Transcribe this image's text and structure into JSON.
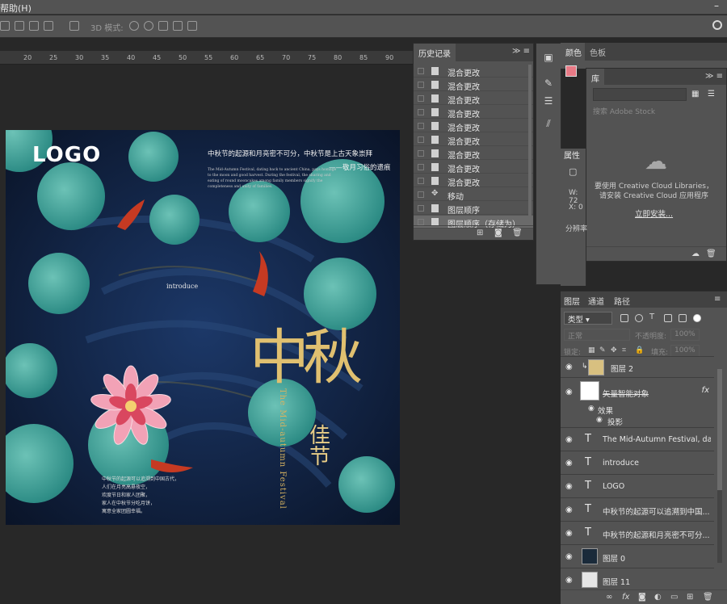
{
  "menubar": {
    "help_label": "帮助(H)"
  },
  "options": {
    "mode3d_label": "3D 模式:"
  },
  "ruler": {
    "ticks": [
      "20",
      "25",
      "30",
      "35",
      "40",
      "45",
      "50",
      "55",
      "60",
      "65",
      "70",
      "75",
      "80",
      "85",
      "90"
    ]
  },
  "poster": {
    "logo": "LOGO",
    "title_line": "中秋节的起源和月亮密不可分，中秋节是上古天象崇拜",
    "sub_line": "——敬月习俗的遗痕",
    "english_small": "The Mid-Autumn Festival, dating back to ancient China, pays homage to the moon and good harvest. During the festival, the sharing and eating of round mooncakes among family members signify the completeness and unity of families.",
    "intro": "introduce",
    "zhongqiu": "中秋",
    "jiajie": "佳节",
    "vertical_en": "The Mid-autumn Festival",
    "bottom_lines": [
      "中秋节的起源可以追溯到中国古代，",
      "人们在月亮高悬夜空，",
      "欢度节日和家人团聚，",
      "家人在中秋节分吃月饼，",
      "寓意全家团圆幸福。"
    ]
  },
  "history": {
    "tab_label": "历史记录",
    "items": [
      {
        "label": "混合更改"
      },
      {
        "label": "混合更改"
      },
      {
        "label": "混合更改"
      },
      {
        "label": "混合更改"
      },
      {
        "label": "混合更改"
      },
      {
        "label": "混合更改"
      },
      {
        "label": "混合更改"
      },
      {
        "label": "混合更改"
      },
      {
        "label": "混合更改"
      },
      {
        "label": "移动"
      },
      {
        "label": "图层顺序"
      },
      {
        "label": "图层顺序（存储为）"
      }
    ]
  },
  "color": {
    "tab1": "颜色",
    "tab2": "色板",
    "swatch_color": "#e87a86"
  },
  "library": {
    "tab_label": "库",
    "search_placeholder": "搜索 Adobe Stock",
    "msg1": "要使用 Creative Cloud Libraries，",
    "msg2": "请安装 Creative Cloud 应用程序",
    "button": "立即安装..."
  },
  "properties": {
    "tab_label": "属性",
    "w_label": "W: 72",
    "x_label": "X: 0",
    "res_label": "分辨率"
  },
  "layers": {
    "tabs": [
      "图层",
      "通道",
      "路径"
    ],
    "kind": "类型",
    "blend": "正常",
    "opacity_label": "不透明度:",
    "opacity_val": "100%",
    "lock_label": "锁定:",
    "fill_label": "填充:",
    "fill_val": "100%",
    "rows": [
      {
        "name": "图层 2",
        "type": "image"
      },
      {
        "name": "矢量智能对象",
        "type": "smart"
      },
      {
        "name": "效果",
        "type": "effect"
      },
      {
        "name": "投影",
        "type": "effect2"
      },
      {
        "name": "The Mid-Autumn Festival, dating ...",
        "type": "text"
      },
      {
        "name": "introduce",
        "type": "text"
      },
      {
        "name": "LOGO",
        "type": "text"
      },
      {
        "name": "中秋节的起源可以追溯到中国...",
        "type": "text"
      },
      {
        "name": "中秋节的起源和月亮密不可分...",
        "type": "text"
      },
      {
        "name": "图层 0",
        "type": "image"
      },
      {
        "name": "图层 11",
        "type": "image"
      }
    ]
  }
}
